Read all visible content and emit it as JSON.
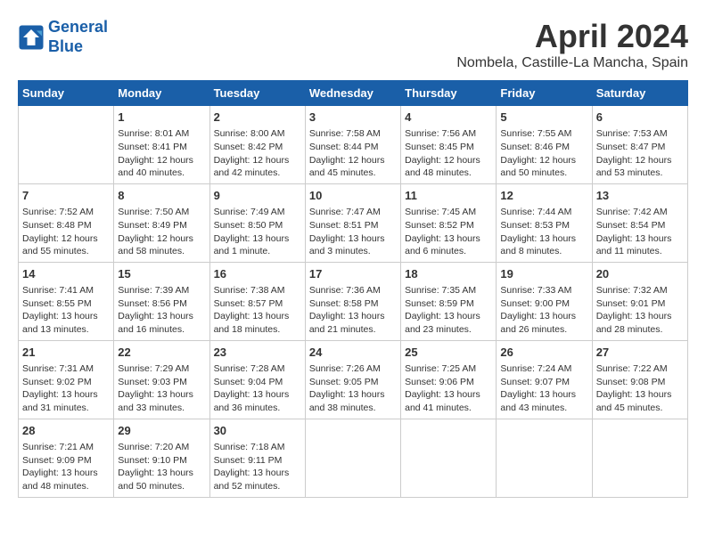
{
  "header": {
    "logo_line1": "General",
    "logo_line2": "Blue",
    "month_year": "April 2024",
    "location": "Nombela, Castille-La Mancha, Spain"
  },
  "weekdays": [
    "Sunday",
    "Monday",
    "Tuesday",
    "Wednesday",
    "Thursday",
    "Friday",
    "Saturday"
  ],
  "weeks": [
    [
      {
        "day": "",
        "info": ""
      },
      {
        "day": "1",
        "info": "Sunrise: 8:01 AM\nSunset: 8:41 PM\nDaylight: 12 hours\nand 40 minutes."
      },
      {
        "day": "2",
        "info": "Sunrise: 8:00 AM\nSunset: 8:42 PM\nDaylight: 12 hours\nand 42 minutes."
      },
      {
        "day": "3",
        "info": "Sunrise: 7:58 AM\nSunset: 8:44 PM\nDaylight: 12 hours\nand 45 minutes."
      },
      {
        "day": "4",
        "info": "Sunrise: 7:56 AM\nSunset: 8:45 PM\nDaylight: 12 hours\nand 48 minutes."
      },
      {
        "day": "5",
        "info": "Sunrise: 7:55 AM\nSunset: 8:46 PM\nDaylight: 12 hours\nand 50 minutes."
      },
      {
        "day": "6",
        "info": "Sunrise: 7:53 AM\nSunset: 8:47 PM\nDaylight: 12 hours\nand 53 minutes."
      }
    ],
    [
      {
        "day": "7",
        "info": "Sunrise: 7:52 AM\nSunset: 8:48 PM\nDaylight: 12 hours\nand 55 minutes."
      },
      {
        "day": "8",
        "info": "Sunrise: 7:50 AM\nSunset: 8:49 PM\nDaylight: 12 hours\nand 58 minutes."
      },
      {
        "day": "9",
        "info": "Sunrise: 7:49 AM\nSunset: 8:50 PM\nDaylight: 13 hours\nand 1 minute."
      },
      {
        "day": "10",
        "info": "Sunrise: 7:47 AM\nSunset: 8:51 PM\nDaylight: 13 hours\nand 3 minutes."
      },
      {
        "day": "11",
        "info": "Sunrise: 7:45 AM\nSunset: 8:52 PM\nDaylight: 13 hours\nand 6 minutes."
      },
      {
        "day": "12",
        "info": "Sunrise: 7:44 AM\nSunset: 8:53 PM\nDaylight: 13 hours\nand 8 minutes."
      },
      {
        "day": "13",
        "info": "Sunrise: 7:42 AM\nSunset: 8:54 PM\nDaylight: 13 hours\nand 11 minutes."
      }
    ],
    [
      {
        "day": "14",
        "info": "Sunrise: 7:41 AM\nSunset: 8:55 PM\nDaylight: 13 hours\nand 13 minutes."
      },
      {
        "day": "15",
        "info": "Sunrise: 7:39 AM\nSunset: 8:56 PM\nDaylight: 13 hours\nand 16 minutes."
      },
      {
        "day": "16",
        "info": "Sunrise: 7:38 AM\nSunset: 8:57 PM\nDaylight: 13 hours\nand 18 minutes."
      },
      {
        "day": "17",
        "info": "Sunrise: 7:36 AM\nSunset: 8:58 PM\nDaylight: 13 hours\nand 21 minutes."
      },
      {
        "day": "18",
        "info": "Sunrise: 7:35 AM\nSunset: 8:59 PM\nDaylight: 13 hours\nand 23 minutes."
      },
      {
        "day": "19",
        "info": "Sunrise: 7:33 AM\nSunset: 9:00 PM\nDaylight: 13 hours\nand 26 minutes."
      },
      {
        "day": "20",
        "info": "Sunrise: 7:32 AM\nSunset: 9:01 PM\nDaylight: 13 hours\nand 28 minutes."
      }
    ],
    [
      {
        "day": "21",
        "info": "Sunrise: 7:31 AM\nSunset: 9:02 PM\nDaylight: 13 hours\nand 31 minutes."
      },
      {
        "day": "22",
        "info": "Sunrise: 7:29 AM\nSunset: 9:03 PM\nDaylight: 13 hours\nand 33 minutes."
      },
      {
        "day": "23",
        "info": "Sunrise: 7:28 AM\nSunset: 9:04 PM\nDaylight: 13 hours\nand 36 minutes."
      },
      {
        "day": "24",
        "info": "Sunrise: 7:26 AM\nSunset: 9:05 PM\nDaylight: 13 hours\nand 38 minutes."
      },
      {
        "day": "25",
        "info": "Sunrise: 7:25 AM\nSunset: 9:06 PM\nDaylight: 13 hours\nand 41 minutes."
      },
      {
        "day": "26",
        "info": "Sunrise: 7:24 AM\nSunset: 9:07 PM\nDaylight: 13 hours\nand 43 minutes."
      },
      {
        "day": "27",
        "info": "Sunrise: 7:22 AM\nSunset: 9:08 PM\nDaylight: 13 hours\nand 45 minutes."
      }
    ],
    [
      {
        "day": "28",
        "info": "Sunrise: 7:21 AM\nSunset: 9:09 PM\nDaylight: 13 hours\nand 48 minutes."
      },
      {
        "day": "29",
        "info": "Sunrise: 7:20 AM\nSunset: 9:10 PM\nDaylight: 13 hours\nand 50 minutes."
      },
      {
        "day": "30",
        "info": "Sunrise: 7:18 AM\nSunset: 9:11 PM\nDaylight: 13 hours\nand 52 minutes."
      },
      {
        "day": "",
        "info": ""
      },
      {
        "day": "",
        "info": ""
      },
      {
        "day": "",
        "info": ""
      },
      {
        "day": "",
        "info": ""
      }
    ]
  ]
}
